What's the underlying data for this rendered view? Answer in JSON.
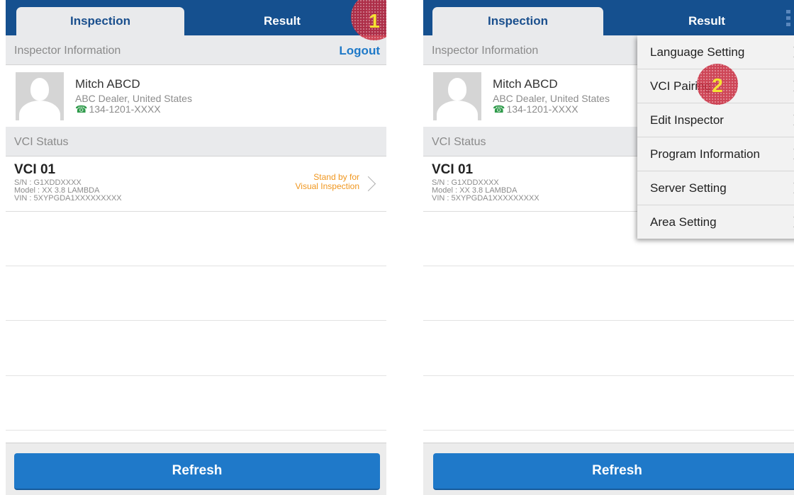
{
  "colors": {
    "header": "#15508f",
    "accent": "#1e79c8",
    "status": "#f0961e",
    "badge": "#c8283c"
  },
  "left": {
    "tabs": [
      {
        "label": "Inspection"
      },
      {
        "label": "Result"
      }
    ],
    "badge": "1",
    "inspector_section": {
      "title": "Inspector Information",
      "logout": "Logout"
    },
    "profile": {
      "name": "Mitch ABCD",
      "dealer": "ABC Dealer, United States",
      "phone": "134-1201-XXXX"
    },
    "vci_section": {
      "title": "VCI Status"
    },
    "vci": {
      "name": "VCI 01",
      "sn": "S/N : G1XDDXXXX",
      "model": "Model : XX 3.8 LAMBDA",
      "vin": "VIN : 5XYPGDA1XXXXXXXXX",
      "status_line1": "Stand by for",
      "status_line2": "Visual Inspection"
    },
    "refresh": "Refresh"
  },
  "right": {
    "tabs": [
      {
        "label": "Inspection"
      },
      {
        "label": "Result"
      }
    ],
    "badge": "2",
    "inspector_section": {
      "title": "Inspector Information"
    },
    "profile": {
      "name": "Mitch ABCD",
      "dealer": "ABC Dealer, United States",
      "phone": "134-1201-XXXX"
    },
    "vci_section": {
      "title": "VCI Status"
    },
    "vci": {
      "name": "VCI 01",
      "sn": "S/N : G1XDDXXXX",
      "model": "Model : XX 3.8 LAMBDA",
      "vin": "VIN : 5XYPGDA1XXXXXXXXX"
    },
    "menu": [
      {
        "label": "Language Setting"
      },
      {
        "label": "VCI Pairing"
      },
      {
        "label": "Edit Inspector"
      },
      {
        "label": "Program Information"
      },
      {
        "label": "Server Setting"
      },
      {
        "label": "Area Setting"
      }
    ],
    "refresh": "Refresh"
  }
}
